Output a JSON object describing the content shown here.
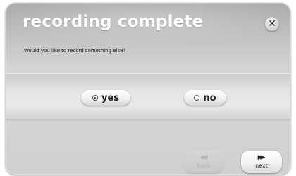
{
  "dialog": {
    "title": "recording complete",
    "close_icon": "close-icon",
    "prompt": "Would you like to record something else?"
  },
  "options": {
    "yes_label": "yes",
    "no_label": "no",
    "selected": "yes"
  },
  "navigation": {
    "back_label": "back",
    "back_icon": "rewind-icon",
    "back_enabled": false,
    "next_label": "next",
    "next_icon": "fast-forward-icon"
  },
  "colors": {
    "title_text": "#ffffff",
    "dialog_gray": "#c4c4c4",
    "button_face": "#f0f0f0"
  }
}
